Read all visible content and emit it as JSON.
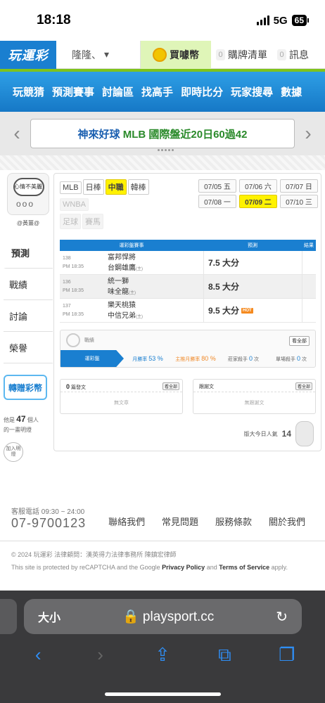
{
  "status": {
    "time": "18:18",
    "network": "5G",
    "battery": "65"
  },
  "nav": {
    "logo": "玩運彩",
    "user": "隆隆、",
    "buy": "買噱幣",
    "orders_badge": "0",
    "orders": "購牌清單",
    "msg_badge": "0",
    "msg": "訊息"
  },
  "menu": [
    "玩競猜",
    "預測賽事",
    "討論區",
    "找高手",
    "即時比分",
    "玩家搜尋",
    "數據"
  ],
  "banner": {
    "part1": "神來好球",
    "part2": "MLB 國際盤近20日60過42"
  },
  "sidebar": {
    "mood": "心情不美麗",
    "username": "@黃薑@",
    "items": [
      "預測",
      "戰績",
      "討論",
      "榮譽"
    ],
    "gift": "轉贈彩幣",
    "count_prefix": "他是",
    "count": "47",
    "count_suffix": "個人",
    "count_line2": "的一畫明燈",
    "add": "加入明燈"
  },
  "leagues": [
    {
      "label": "MLB",
      "state": "normal"
    },
    {
      "label": "日棒",
      "state": "normal"
    },
    {
      "label": "中職",
      "state": "active"
    },
    {
      "label": "韓棒",
      "state": "normal"
    },
    {
      "label": "WNBA",
      "state": "dim"
    },
    {
      "label": "足球",
      "state": "dim"
    },
    {
      "label": "賽馬",
      "state": "dim"
    }
  ],
  "dates": [
    {
      "label": "07/05 五",
      "active": false
    },
    {
      "label": "07/06 六",
      "active": false
    },
    {
      "label": "07/07 日",
      "active": false
    },
    {
      "label": "07/08 一",
      "active": false
    },
    {
      "label": "07/09 二",
      "active": true
    },
    {
      "label": "07/10 三",
      "active": false
    }
  ],
  "table": {
    "headers": [
      "運彩盤賽事",
      "預測",
      "結果"
    ],
    "rows": [
      {
        "no": "138",
        "time": "PM 18:35",
        "away": "富邦悍將",
        "home": "台鋼雄鷹",
        "home_tag": "(主)",
        "pick": "7.5 大分",
        "hot": ""
      },
      {
        "no": "136",
        "time": "PM 18:35",
        "away": "統一獅",
        "home": "味全龍",
        "home_tag": "(主)",
        "pick": "8.5 大分",
        "hot": ""
      },
      {
        "no": "137",
        "time": "PM 18:35",
        "away": "樂天桃猿",
        "home": "中信兄弟",
        "home_tag": "(主)",
        "pick": "9.5 大分",
        "hot": "HOT"
      }
    ]
  },
  "stats": {
    "label": "戰績",
    "see_all": "看全部",
    "tab": "運彩盤",
    "month_win_label": "月勝率",
    "month_win": "53 %",
    "main_win_label": "主推月勝率",
    "main_win": "80 %",
    "kill1_label": "莊家殺手",
    "kill1": "0",
    "kill1_unit": "次",
    "kill2_label": "單場殺手",
    "kill2": "0",
    "kill2_unit": "次"
  },
  "posts": {
    "left_count": "0",
    "left_label": "篇發文",
    "left_empty": "無文章",
    "right_label": "跟謝文",
    "right_empty": "無跟謝文",
    "see": "看全部"
  },
  "popularity": {
    "label": "版大今日人氣",
    "value": "14"
  },
  "footer": {
    "phone_label": "客服電話 09:30 ~ 24:00",
    "phone": "07-9700123",
    "links": [
      "聯絡我們",
      "常見問題",
      "服務條款",
      "關於我們"
    ],
    "copyright": "© 2024 玩運彩 法律顧問：漢英得力法律事務所 陳鎮宏律師",
    "captcha_pre": "This site is protected by reCAPTCHA and the Google",
    "privacy": "Privacy Policy",
    "and": "and",
    "terms": "Terms of Service",
    "apply": "apply."
  },
  "browser": {
    "aa": "大小",
    "url": "playsport.cc"
  }
}
